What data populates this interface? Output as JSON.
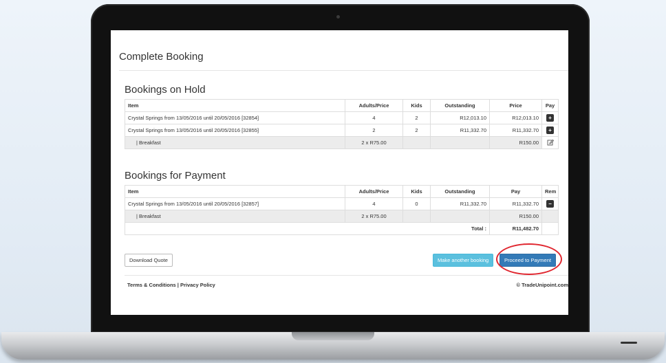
{
  "page": {
    "title": "Complete Booking"
  },
  "on_hold": {
    "heading": "Bookings on Hold",
    "columns": [
      "Item",
      "Adults/Price",
      "Kids",
      "Outstanding",
      "Price",
      "Pay"
    ],
    "rows": [
      {
        "item": "Crystal Springs from 13/05/2016 until 20/05/2016 [32854]",
        "adults": "4",
        "kids": "2",
        "outstanding": "R12,013.10",
        "price": "R12,013.10",
        "action_icon": "plus-square-icon"
      },
      {
        "item": "Crystal Springs from 13/05/2016 until 20/05/2016 [32855]",
        "adults": "2",
        "kids": "2",
        "outstanding": "R11,332.70",
        "price": "R11,332.70",
        "action_icon": "plus-square-icon"
      },
      {
        "item": "| Breakfast",
        "adults": "2 x R75.00",
        "kids": "",
        "outstanding": "",
        "price": "R150.00",
        "action_icon": "edit-icon"
      }
    ]
  },
  "for_payment": {
    "heading": "Bookings for Payment",
    "columns": [
      "Item",
      "Adults/Price",
      "Kids",
      "Outstanding",
      "Pay",
      "Rem"
    ],
    "rows": [
      {
        "item": "Crystal Springs from 13/05/2016 until 20/05/2016 [32857]",
        "adults": "4",
        "kids": "0",
        "outstanding": "R11,332.70",
        "pay": "R11,332.70",
        "action_icon": "minus-square-icon"
      },
      {
        "item": "| Breakfast",
        "adults": "2 x R75.00",
        "kids": "",
        "outstanding": "",
        "pay": "R150.00"
      }
    ],
    "total_label": "Total :",
    "total_value": "R11,482.70"
  },
  "buttons": {
    "download_quote": "Download Quote",
    "make_another": "Make another booking",
    "proceed": "Proceed to Payment"
  },
  "footer": {
    "links": "Terms & Conditions | Privacy Policy",
    "copyright": "© TradeUnipoint.com"
  },
  "colors": {
    "primary": "#337ab7",
    "info": "#5bc0de",
    "highlight": "#e0262f"
  }
}
